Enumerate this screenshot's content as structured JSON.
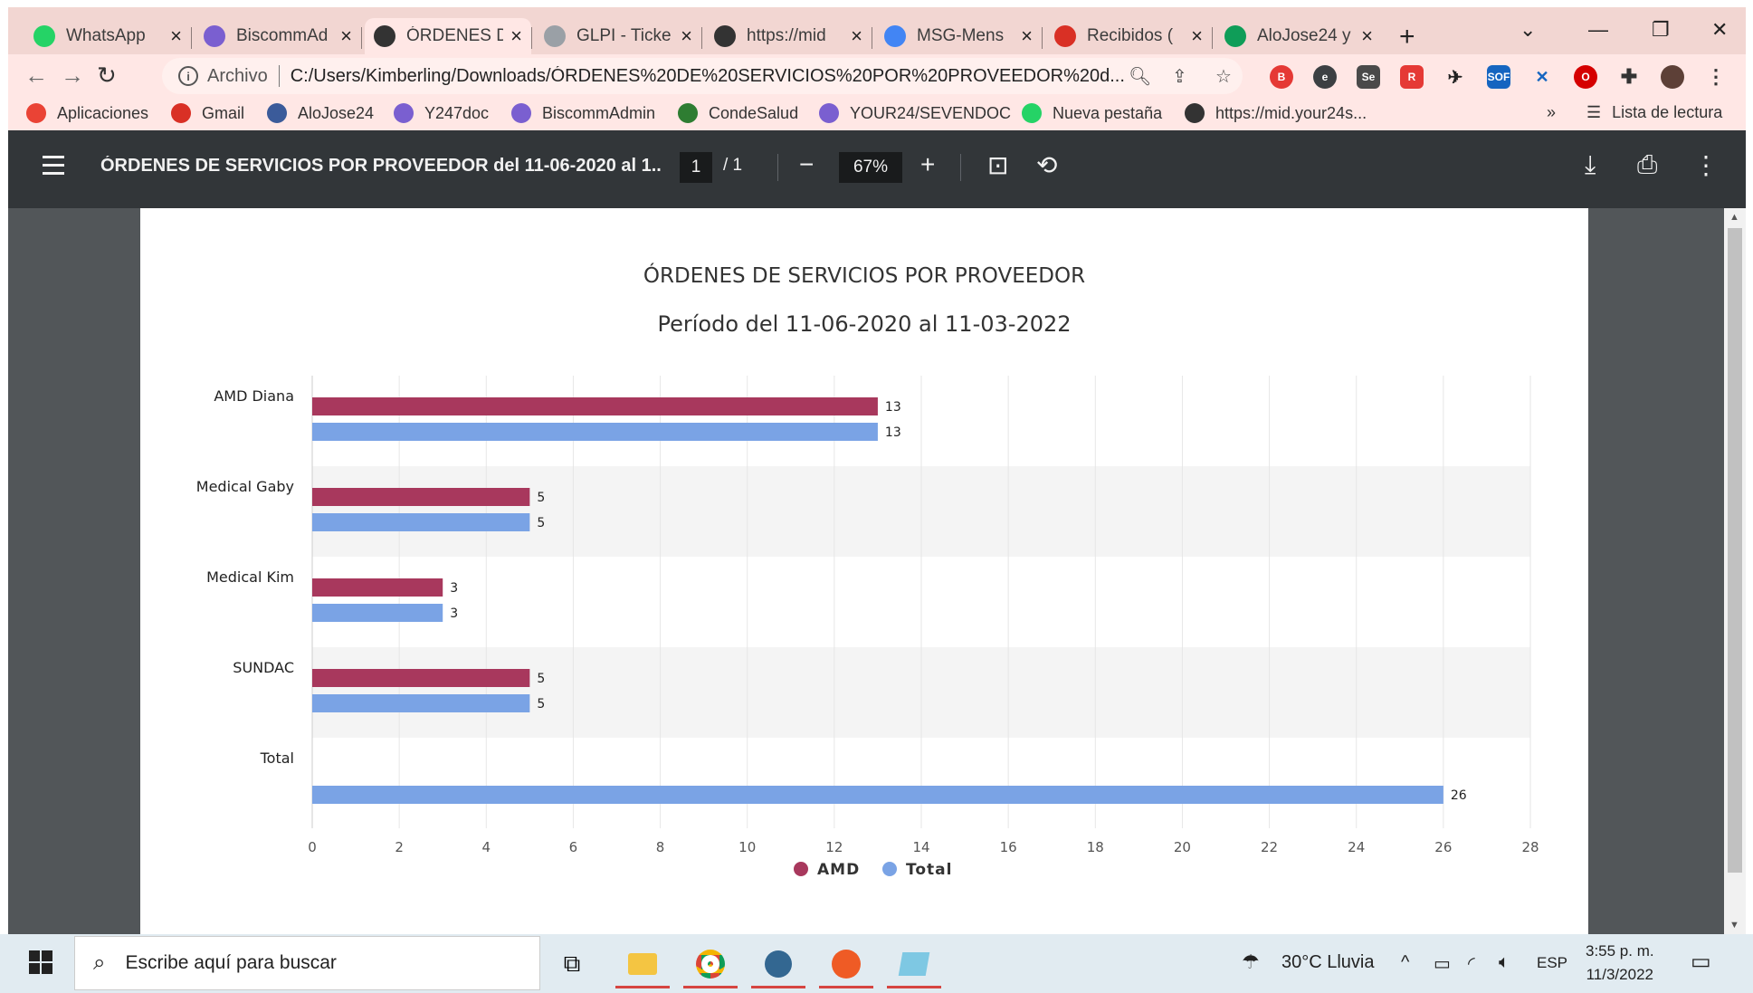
{
  "browser": {
    "tabs": [
      {
        "title": "WhatsApp",
        "icon": "whatsapp-icon",
        "color": "#25d366"
      },
      {
        "title": "BiscommAd",
        "icon": "biscomm-icon",
        "color": "#7a5fd0"
      },
      {
        "title": "ÓRDENES D",
        "icon": "globe-icon",
        "color": "#333333",
        "active": true
      },
      {
        "title": "GLPI - Ticke",
        "icon": "glpi-icon",
        "color": "#9aa0a6"
      },
      {
        "title": "https://mid",
        "icon": "globe-icon",
        "color": "#333333"
      },
      {
        "title": "MSG-Mens",
        "icon": "docs-icon",
        "color": "#4285f4"
      },
      {
        "title": "Recibidos (",
        "icon": "gmail-icon",
        "color": "#d93025"
      },
      {
        "title": "AloJose24 y",
        "icon": "drive-icon",
        "color": "#0f9d58"
      }
    ],
    "new_tab_label": "+",
    "address": {
      "scheme": "Archivo",
      "url": "C:/Users/Kimberling/Downloads/ÓRDENES%20DE%20SERVICIOS%20POR%20PROVEEDOR%20d..."
    },
    "bookmarks": [
      {
        "label": "Aplicaciones",
        "icon": "apps-grid-icon",
        "color": "#ea4335"
      },
      {
        "label": "Gmail",
        "icon": "gmail-icon",
        "color": "#d93025"
      },
      {
        "label": "AloJose24",
        "icon": "bookmark-page-icon",
        "color": "#3b5b9a"
      },
      {
        "label": "Y247doc",
        "icon": "y247-icon",
        "color": "#7a5fd0"
      },
      {
        "label": "BiscommAdmin",
        "icon": "biscomm-icon",
        "color": "#7a5fd0"
      },
      {
        "label": "CondeSalud",
        "icon": "shield-icon",
        "color": "#2e7d32"
      },
      {
        "label": "YOUR24/SEVENDOC",
        "icon": "y247-icon",
        "color": "#7a5fd0"
      },
      {
        "label": "Nueva pestaña",
        "icon": "whatsapp-icon",
        "color": "#25d366"
      },
      {
        "label": "https://mid.your24s...",
        "icon": "globe-icon",
        "color": "#333333"
      }
    ],
    "bookmarks_overflow": "»",
    "reading_list": "Lista de lectura"
  },
  "pdf": {
    "title": "ÓRDENES DE SERVICIOS POR PROVEEDOR del 11-06-2020 al 1...",
    "page_current": "1",
    "page_total": "/  1",
    "zoom": "67%"
  },
  "chart_data": {
    "type": "bar",
    "orientation": "horizontal",
    "title": "ÓRDENES DE SERVICIOS POR PROVEEDOR",
    "subtitle": "Período del 11-06-2020 al 11-03-2022",
    "categories": [
      "AMD Diana",
      "Medical Gaby",
      "Medical Kim",
      "SUNDAC",
      "Total"
    ],
    "series": [
      {
        "name": "AMD",
        "color": "#a8385d",
        "values": [
          13,
          5,
          3,
          5,
          null
        ]
      },
      {
        "name": "Total",
        "color": "#7aa3e5",
        "values": [
          13,
          5,
          3,
          5,
          26
        ]
      }
    ],
    "xlim": [
      0,
      28
    ],
    "xticks": [
      0,
      2,
      4,
      6,
      8,
      10,
      12,
      14,
      16,
      18,
      20,
      22,
      24,
      26,
      28
    ],
    "grid": true,
    "legend": "bottom-center",
    "data_labels": true
  },
  "taskbar": {
    "search_placeholder": "Escribe aquí para buscar",
    "weather": "30°C  Lluvia",
    "language": "ESP",
    "time": "3:55 p. m.",
    "date": "11/3/2022"
  }
}
